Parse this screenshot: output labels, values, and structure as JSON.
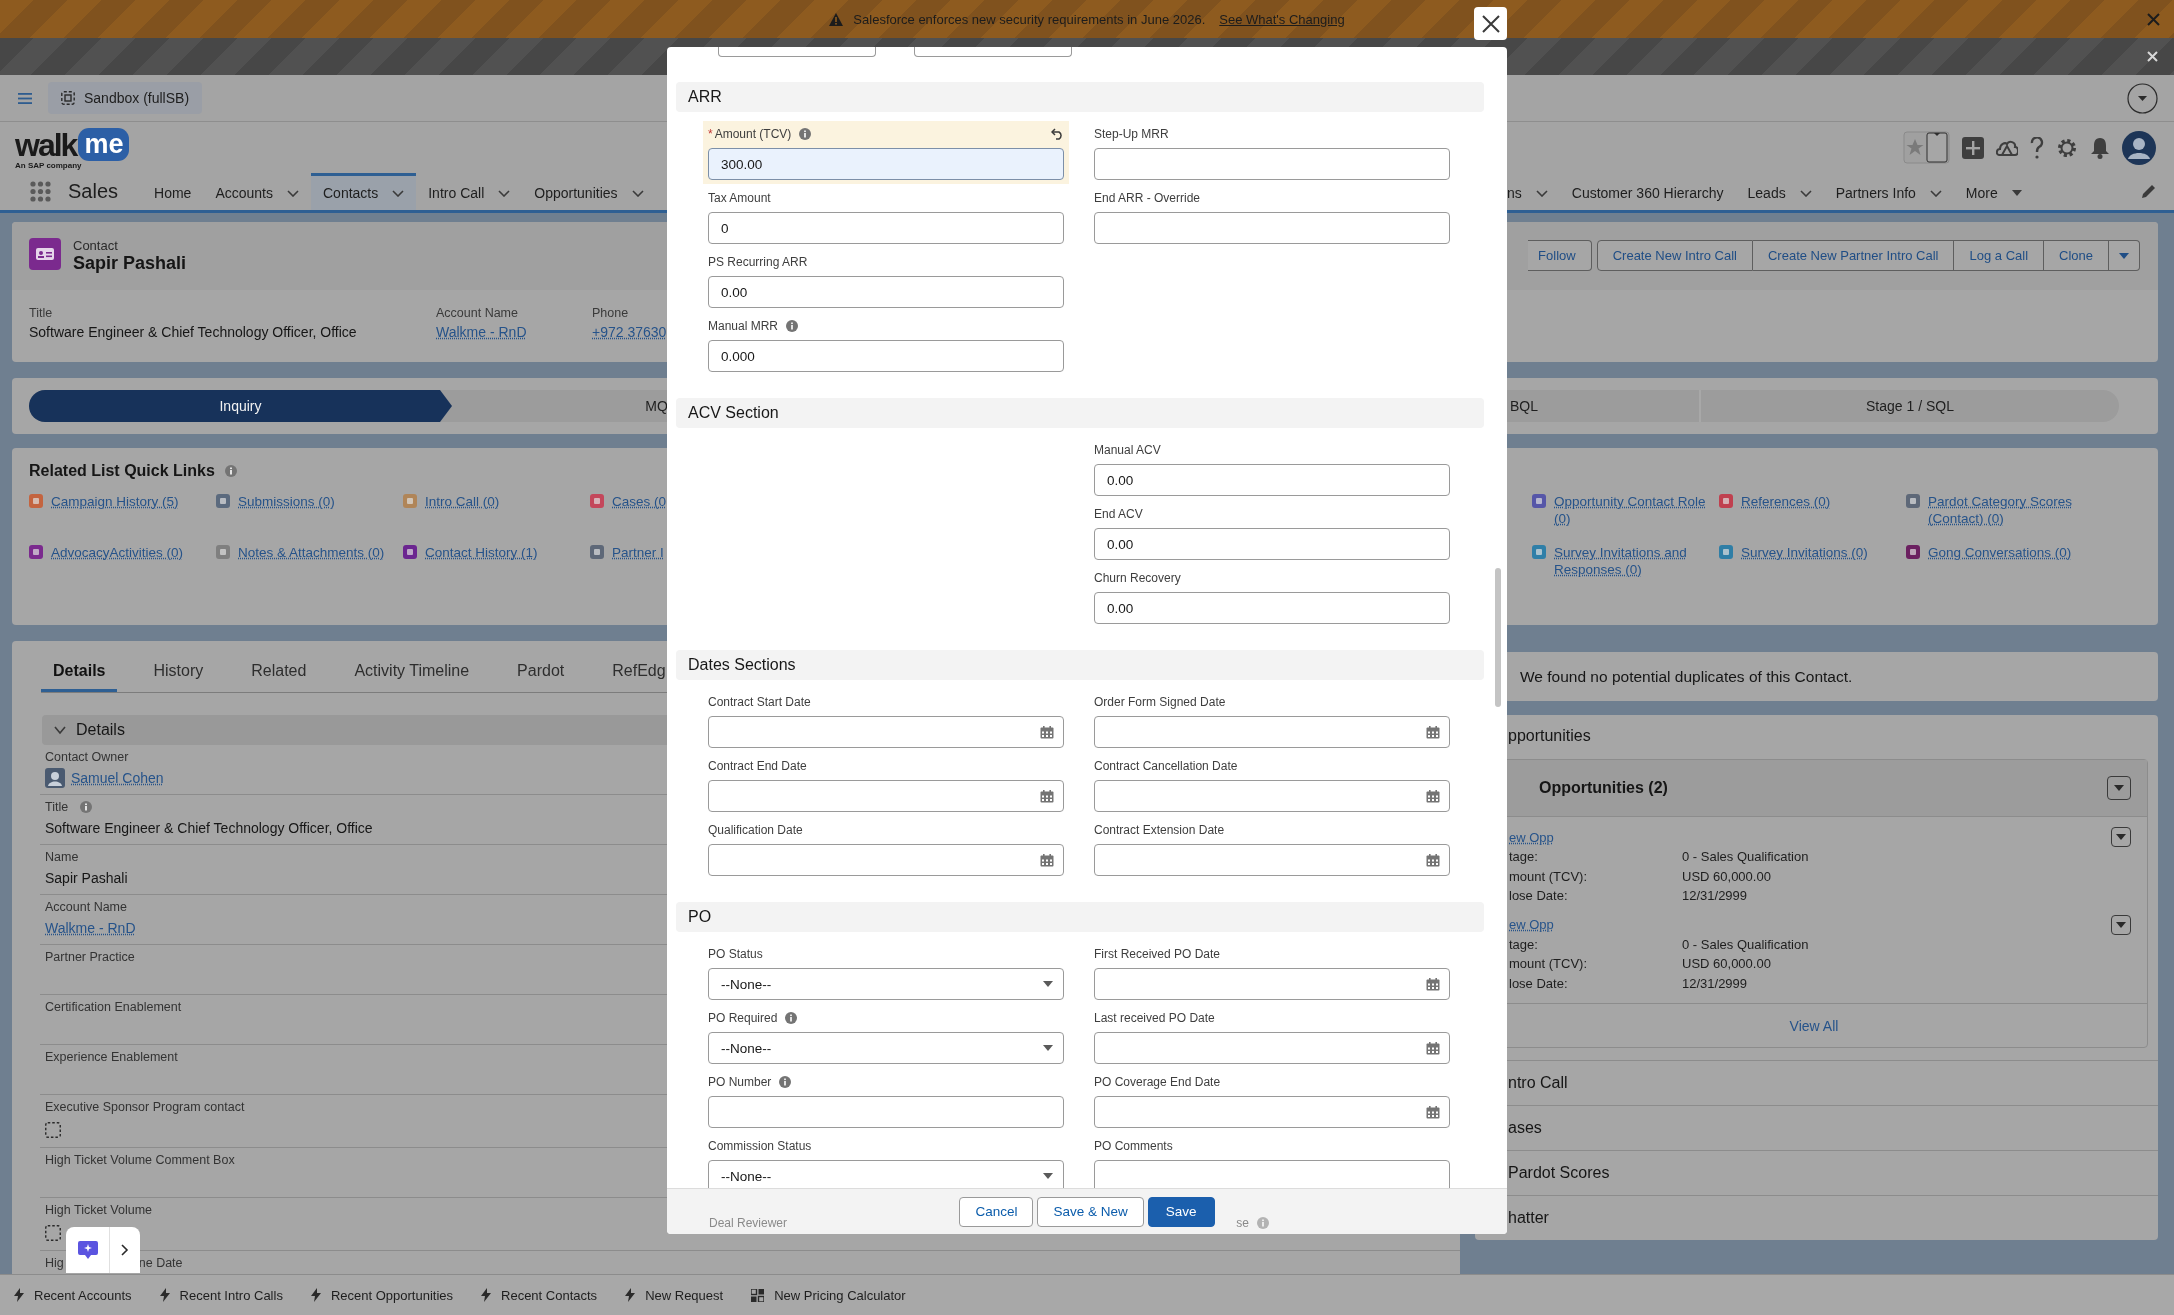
{
  "banner": {
    "message": "Salesforce enforces new security requirements in June 2026.",
    "link": "See What's Changing"
  },
  "sandbox": {
    "label": "Sandbox (fullSB)"
  },
  "logo": {
    "word": "walk",
    "bubble": "me",
    "tagline": "An SAP company"
  },
  "nav": {
    "app_name": "Sales",
    "tabs_left": [
      {
        "label": "Home",
        "kind": "plain",
        "selected": false
      },
      {
        "label": "Accounts",
        "kind": "menu",
        "selected": false
      },
      {
        "label": "Contacts",
        "kind": "menu",
        "selected": true
      },
      {
        "label": "Intro Call",
        "kind": "menu",
        "selected": false
      },
      {
        "label": "Opportunities",
        "kind": "menu",
        "selected": false
      }
    ],
    "tabs_right": [
      {
        "label": "ns",
        "kind": "menu",
        "selected": false
      },
      {
        "label": "Customer 360 Hierarchy",
        "kind": "plain",
        "selected": false
      },
      {
        "label": "Leads",
        "kind": "menu",
        "selected": false
      },
      {
        "label": "Partners Info",
        "kind": "menu",
        "selected": false
      },
      {
        "label": "More",
        "kind": "overflow",
        "selected": false
      }
    ]
  },
  "record": {
    "object": "Contact",
    "name": "Sapir Pashali",
    "fields": [
      {
        "label": "Title",
        "value": "Software Engineer & Chief Technology Officer, Office",
        "link": false
      },
      {
        "label": "Account Name",
        "value": "Walkme - RnD",
        "link": true
      },
      {
        "label": "Phone",
        "value": "+972 37630",
        "link": true
      }
    ],
    "actions": [
      "Follow",
      "Create New Intro Call",
      "Create New Partner Intro Call",
      "Log a Call",
      "Clone"
    ]
  },
  "path": {
    "stages_left": [
      {
        "label": "Inquiry",
        "current": true
      },
      {
        "label": "MQ",
        "current": false
      }
    ],
    "stages_right": [
      {
        "label": "BQL",
        "current": false
      },
      {
        "label": "Stage 1 / SQL",
        "current": false
      }
    ]
  },
  "quick_links": {
    "title": "Related List Quick Links",
    "left": [
      {
        "label": "Campaign History (5)",
        "color": "#c4643f"
      },
      {
        "label": "Submissions (0)",
        "color": "#5b6a7e"
      },
      {
        "label": "Intro Call (0)",
        "color": "#b08558"
      },
      {
        "label": "Cases (0",
        "color": "#c4475b"
      },
      {
        "label": "AdvocacyActivities (0)",
        "color": "#7b2a8e"
      },
      {
        "label": "Notes & Attachments (0)",
        "color": "#7f7f7f"
      },
      {
        "label": "Contact History (1)",
        "color": "#6b2590"
      },
      {
        "label": "Partner I",
        "color": "#5e6878"
      }
    ],
    "right": [
      {
        "label": "Opportunity Contact Role (0)",
        "color": "#5656a8"
      },
      {
        "label": "References (0)",
        "color": "#c0404f"
      },
      {
        "label": "Pardot Category Scores (Contact) (0)",
        "color": "#5e6878"
      },
      {
        "label": "Survey Invitations and Responses (0)",
        "color": "#2f7fa8"
      },
      {
        "label": "Survey Invitations (0)",
        "color": "#2f7ea6"
      },
      {
        "label": "Gong Conversations (0)",
        "color": "#6b2060"
      }
    ]
  },
  "details": {
    "tabs": [
      {
        "label": "Details",
        "selected": true
      },
      {
        "label": "History",
        "selected": false
      },
      {
        "label": "Related",
        "selected": false
      },
      {
        "label": "Activity Timeline",
        "selected": false
      },
      {
        "label": "Pardot",
        "selected": false
      },
      {
        "label": "RefEdg",
        "selected": false
      }
    ],
    "section": {
      "title": "Details",
      "expanded": true
    },
    "fields": [
      {
        "kind": "user",
        "label": "Contact Owner",
        "value": "Samuel Cohen",
        "info": false
      },
      {
        "kind": "text",
        "label": "Title",
        "value": "Software Engineer & Chief Technology Officer, Office",
        "info": true
      },
      {
        "kind": "text",
        "label": "Name",
        "value": "Sapir Pashali",
        "info": false
      },
      {
        "kind": "link",
        "label": "Account Name",
        "value": "Walkme - RnD",
        "info": false
      },
      {
        "kind": "text",
        "label": "Partner Practice",
        "info": false
      },
      {
        "kind": "text",
        "label": "Certification Enablement",
        "info": false
      },
      {
        "kind": "text",
        "label": "Experience Enablement",
        "info": false
      },
      {
        "kind": "checkbox",
        "label": "Executive Sponsor Program contact",
        "checked": false,
        "info": false
      },
      {
        "kind": "text",
        "label": "High Ticket Volume Comment Box",
        "info": false
      },
      {
        "kind": "checkbox",
        "label": "High Ticket Volume",
        "checked": false,
        "info": false
      },
      {
        "kind": "text",
        "label_parts": [
          "Hig",
          "ne Date"
        ],
        "info": false
      }
    ]
  },
  "duplicates": {
    "message": "We found no potential duplicates of this Contact."
  },
  "opportunities": {
    "heading": "pportunities",
    "list_title": "Opportunities (2)",
    "items": [
      {
        "name": "ew Opp",
        "rows": [
          {
            "label": "tage:",
            "value": "0 - Sales Qualification"
          },
          {
            "label": "mount (TCV):",
            "value": "USD 60,000.00"
          },
          {
            "label": "lose Date:",
            "value": "12/31/2999"
          }
        ]
      },
      {
        "name": "ew Opp",
        "rows": [
          {
            "label": "tage:",
            "value": "0 - Sales Qualification"
          },
          {
            "label": "mount (TCV):",
            "value": "USD 60,000.00"
          },
          {
            "label": "lose Date:",
            "value": "12/31/2999"
          }
        ]
      }
    ],
    "view_all": "View All"
  },
  "collapsed_sections": [
    "ntro Call",
    "ases",
    "Pardot Scores",
    "hatter"
  ],
  "utility_bar": [
    {
      "label": "Recent Accounts",
      "kind": "action"
    },
    {
      "label": "Recent Intro Calls",
      "kind": "action"
    },
    {
      "label": "Recent Opportunities",
      "kind": "action"
    },
    {
      "label": "Recent Contacts",
      "kind": "action"
    },
    {
      "label": "New Request",
      "kind": "action"
    },
    {
      "label": "New Pricing Calculator",
      "kind": "tool"
    }
  ],
  "modal": {
    "required_mark": "*",
    "sections": [
      {
        "title": "ARR",
        "left": [
          {
            "kind": "text",
            "label": "Amount (TCV)",
            "value": "300.00",
            "required": true,
            "info": true,
            "edited": true
          },
          {
            "kind": "text",
            "label": "Tax Amount",
            "value": "0",
            "required": false,
            "info": false,
            "edited": false
          },
          {
            "kind": "text",
            "label": "PS Recurring ARR",
            "value": "0.00",
            "required": false,
            "info": false,
            "edited": false
          },
          {
            "kind": "text",
            "label": "Manual MRR",
            "value": "0.000",
            "required": false,
            "info": true,
            "edited": false
          }
        ],
        "right": [
          {
            "kind": "text",
            "label": "Step-Up MRR",
            "required": false,
            "info": false,
            "edited": false
          },
          {
            "kind": "text",
            "label": "End ARR - Override",
            "required": false,
            "info": false,
            "edited": false
          }
        ]
      },
      {
        "title": "ACV Section",
        "right": [
          {
            "kind": "text",
            "label": "Manual ACV",
            "value": "0.00",
            "required": false,
            "info": false,
            "edited": false
          },
          {
            "kind": "text",
            "label": "End ACV",
            "value": "0.00",
            "required": false,
            "info": false,
            "edited": false
          },
          {
            "kind": "text",
            "label": "Churn Recovery",
            "value": "0.00",
            "required": false,
            "info": false,
            "edited": false
          }
        ]
      },
      {
        "title": "Dates Sections",
        "left": [
          {
            "kind": "date",
            "label": "Contract Start Date",
            "required": false,
            "info": false,
            "edited": false
          },
          {
            "kind": "date",
            "label": "Contract End Date",
            "required": false,
            "info": false,
            "edited": false
          },
          {
            "kind": "date",
            "label": "Qualification Date",
            "required": false,
            "info": false,
            "edited": false
          }
        ],
        "right": [
          {
            "kind": "date",
            "label": "Order Form Signed Date",
            "required": false,
            "info": false,
            "edited": false
          },
          {
            "kind": "date",
            "label": "Contract Cancellation Date",
            "required": false,
            "info": false,
            "edited": false
          },
          {
            "kind": "date",
            "label": "Contract Extension Date",
            "required": false,
            "info": false,
            "edited": false
          }
        ]
      },
      {
        "title": "PO",
        "left": [
          {
            "kind": "picklist",
            "label": "PO Status",
            "value": "--None--",
            "required": false,
            "info": false,
            "edited": false
          },
          {
            "kind": "picklist",
            "label": "PO Required",
            "value": "--None--",
            "required": false,
            "info": true,
            "edited": false
          },
          {
            "kind": "text",
            "label": "PO Number",
            "required": false,
            "info": true,
            "edited": false
          },
          {
            "kind": "picklist",
            "label": "Commission Status",
            "value": "--None--",
            "required": false,
            "info": false,
            "edited": false
          }
        ],
        "right": [
          {
            "kind": "date",
            "label": "First Received PO Date",
            "required": false,
            "info": false,
            "edited": false
          },
          {
            "kind": "date",
            "label": "Last received PO Date",
            "required": false,
            "info": false,
            "edited": false
          },
          {
            "kind": "date",
            "label": "PO Coverage End Date",
            "required": false,
            "info": false,
            "edited": false
          },
          {
            "kind": "textarea",
            "label": "PO Comments",
            "required": false,
            "info": false,
            "edited": false
          }
        ]
      }
    ],
    "faded": [
      {
        "label": "Deal Reviewer",
        "info": false
      },
      {
        "label": "se",
        "info": true
      }
    ],
    "buttons": [
      {
        "label": "Cancel",
        "kind": "neutral"
      },
      {
        "label": "Save & New",
        "kind": "neutral"
      },
      {
        "label": "Save",
        "kind": "brand"
      }
    ]
  }
}
